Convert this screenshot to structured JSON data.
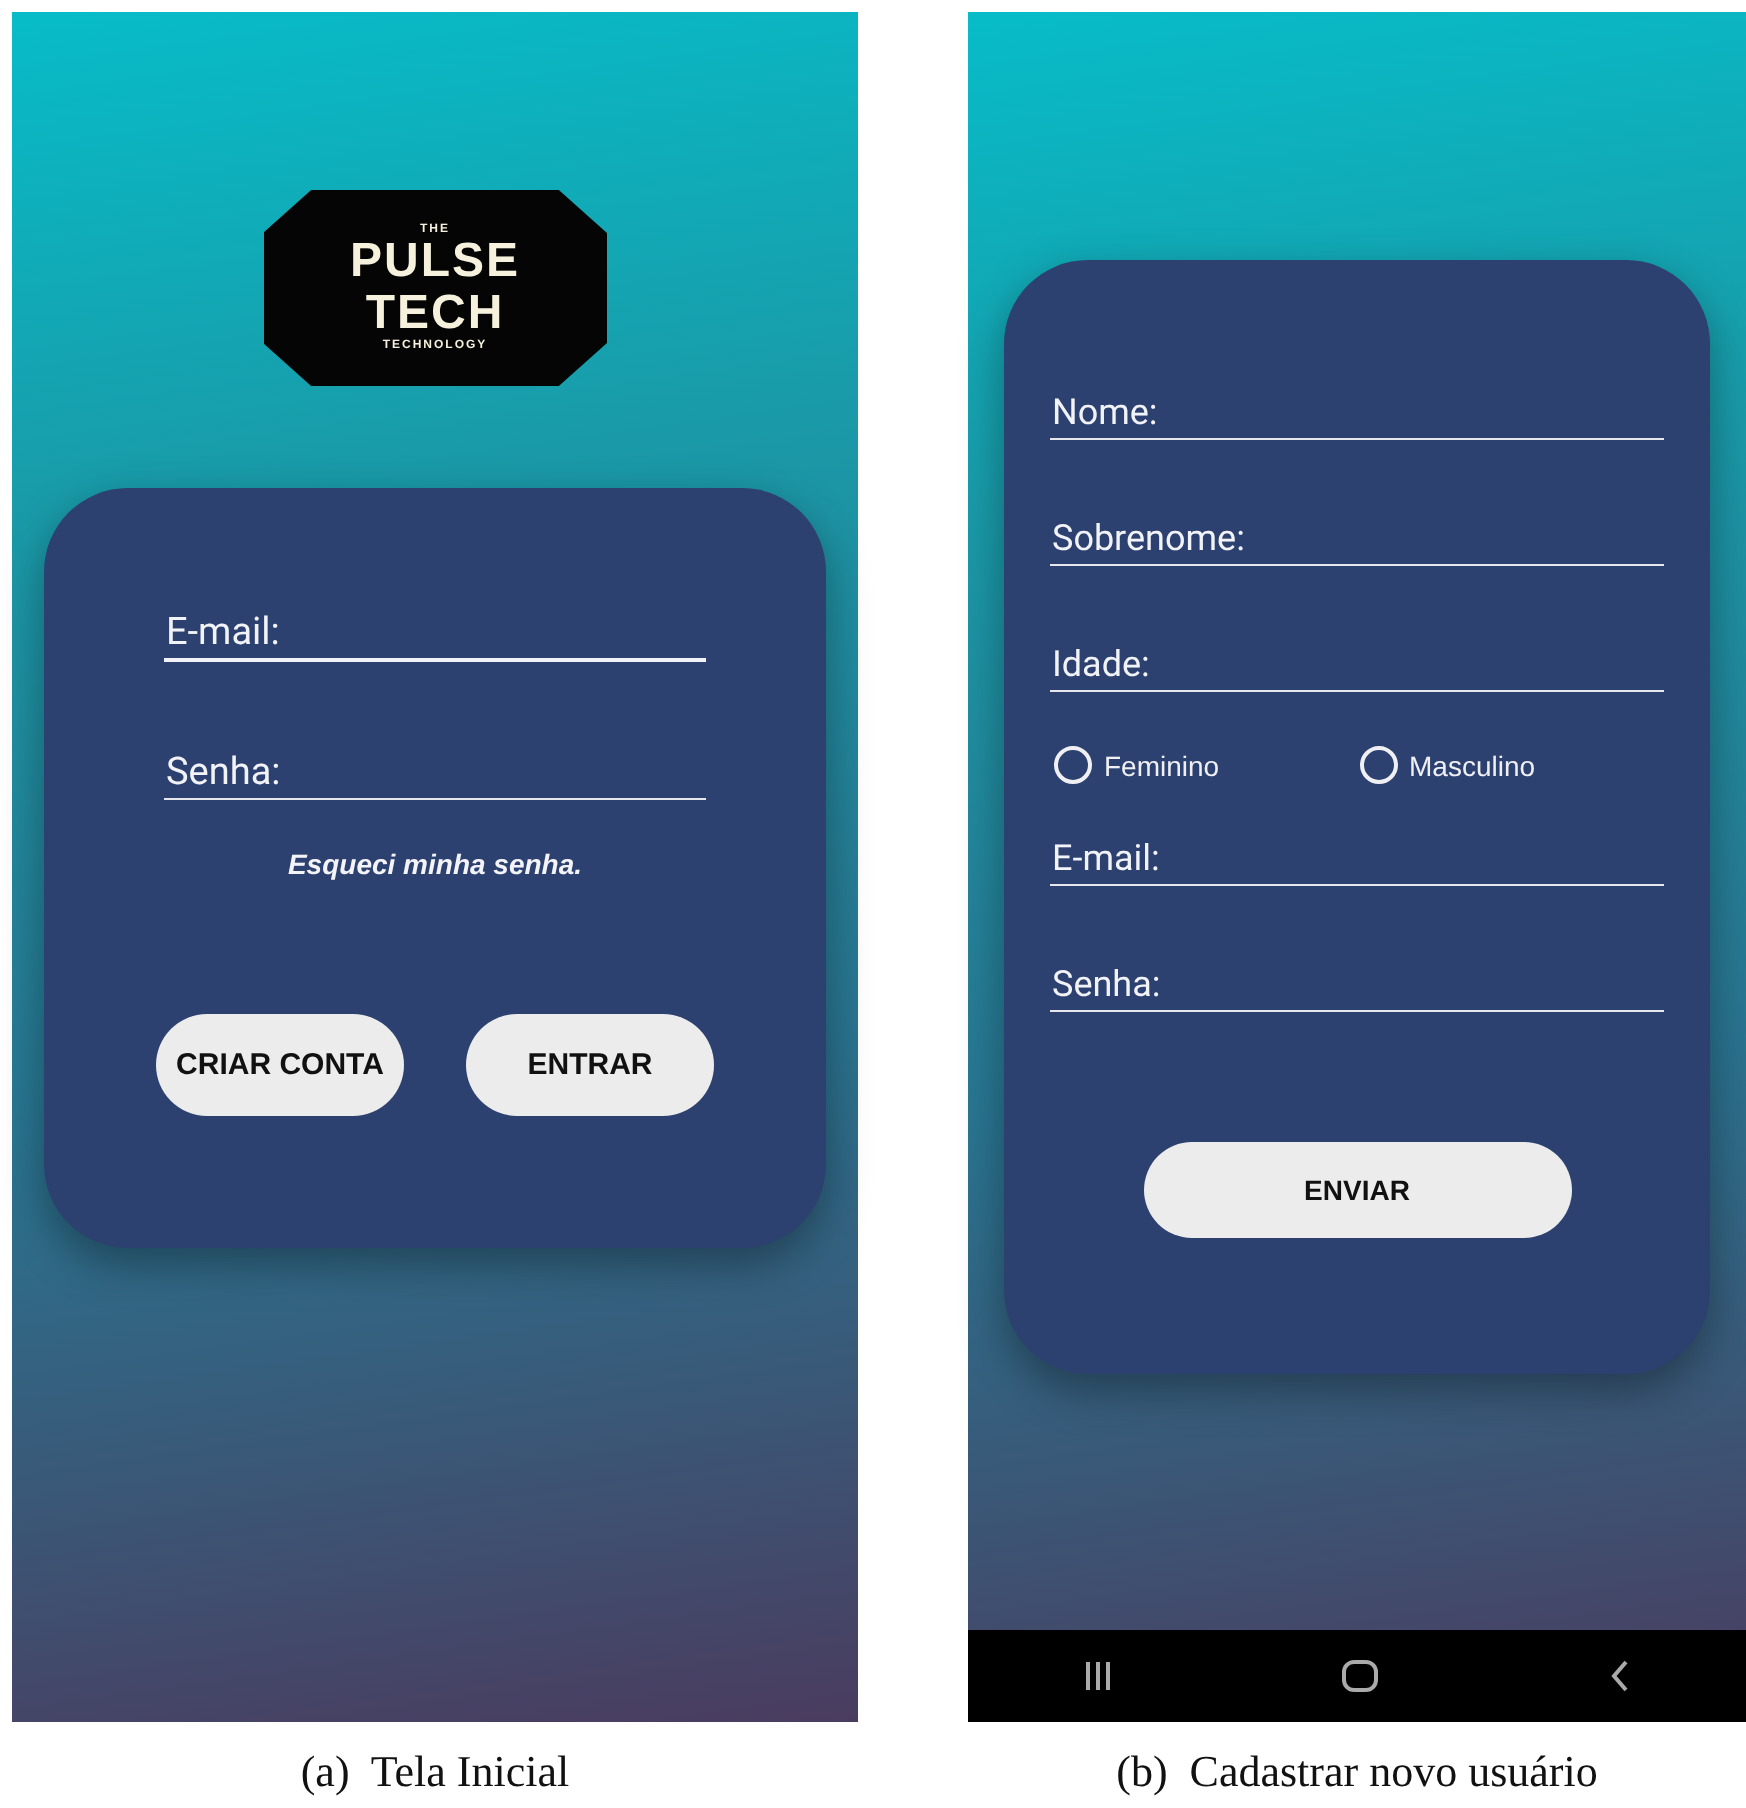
{
  "screens": [
    {
      "kind": "login",
      "logo": {
        "top": "THE",
        "line1": "PULSE",
        "line2": "TECH",
        "bottom": "TECHNOLOGY"
      },
      "fields": [
        {
          "placeholder": "E-mail:",
          "focused": true
        },
        {
          "placeholder": "Senha:",
          "focused": false
        }
      ],
      "link": "Esqueci minha senha.",
      "buttons": [
        "CRIAR CONTA",
        "ENTRAR"
      ],
      "caption": "(a)  Tela Inicial"
    },
    {
      "kind": "signup",
      "fields": [
        {
          "placeholder": "Nome:",
          "focused": false
        },
        {
          "placeholder": "Sobrenome:",
          "focused": false
        },
        {
          "placeholder": "Idade:",
          "focused": false
        }
      ],
      "radios": [
        {
          "label": "Feminino",
          "selected": false
        },
        {
          "label": "Masculino",
          "selected": false
        }
      ],
      "fields2": [
        {
          "placeholder": "E-mail:",
          "focused": false
        },
        {
          "placeholder": "Senha:",
          "focused": false
        }
      ],
      "buttons": [
        "ENVIAR"
      ],
      "caption": "(b)  Cadastrar novo usuário"
    }
  ]
}
